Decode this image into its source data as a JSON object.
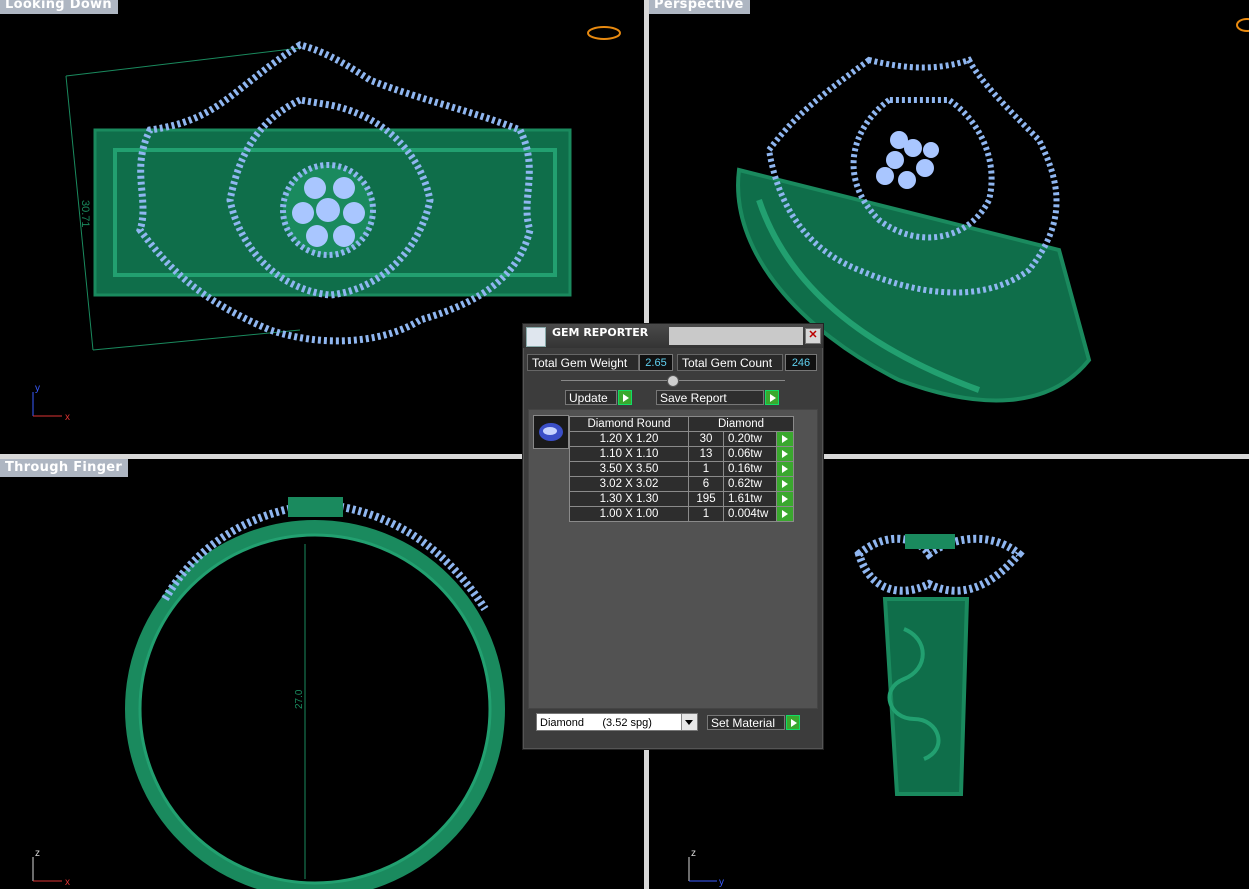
{
  "viewports": {
    "top_left": {
      "label": "Looking Down",
      "dimension": "30.71"
    },
    "top_right": {
      "label": "Perspective"
    },
    "bottom_left": {
      "label": "Through Finger",
      "dimension": "27.0"
    },
    "bottom_right": {
      "label": ""
    }
  },
  "axes": {
    "y": "y",
    "x": "x",
    "z": "z"
  },
  "colors": {
    "metal": "#1a8a5e",
    "gem": "#8fb6f0",
    "panel_bg": "#3c3c3c",
    "accent_green": "#3aa82e",
    "value_cyan": "#5fd0f0"
  },
  "gem_reporter": {
    "title": "GEM REPORTER",
    "total_weight_label": "Total Gem Weight",
    "total_weight_value": "2.65",
    "total_count_label": "Total Gem Count",
    "total_count_value": "246",
    "update_label": "Update",
    "save_report_label": "Save Report",
    "header_shape": "Diamond Round",
    "header_material": "Diamond",
    "rows": [
      {
        "size": "1.20 X 1.20",
        "count": "30",
        "weight": "0.20tw"
      },
      {
        "size": "1.10 X 1.10",
        "count": "13",
        "weight": "0.06tw"
      },
      {
        "size": "3.50 X 3.50",
        "count": "1",
        "weight": "0.16tw"
      },
      {
        "size": "3.02 X 3.02",
        "count": "6",
        "weight": "0.62tw"
      },
      {
        "size": "1.30 X 1.30",
        "count": "195",
        "weight": "1.61tw"
      },
      {
        "size": "1.00 X 1.00",
        "count": "1",
        "weight": "0.004tw"
      }
    ],
    "material_select": "Diamond      (3.52 spg)",
    "set_material_label": "Set Material"
  }
}
